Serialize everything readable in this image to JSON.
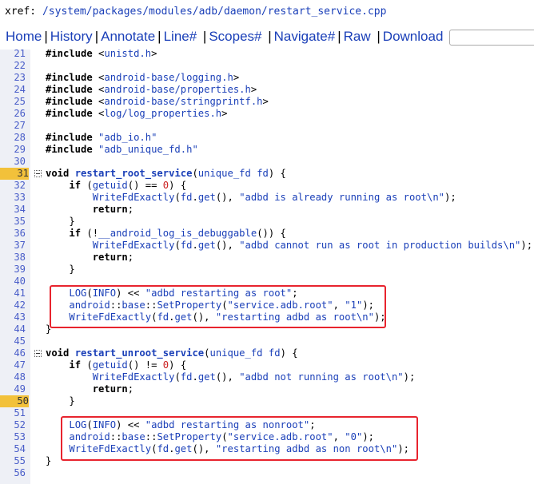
{
  "header": {
    "prefix": "xref: ",
    "path": "/system/packages/modules/adb/daemon/restart_service.cpp"
  },
  "nav": {
    "home": "Home",
    "history": "History",
    "annotate": "Annotate",
    "line": "Line#",
    "scopes": "Scopes#",
    "navigate": "Navigate#",
    "raw": "Raw",
    "download": "Download",
    "search_value": ""
  },
  "code_lines": [
    {
      "n": "21",
      "t": "#include <unistd.h>"
    },
    {
      "n": "22",
      "t": ""
    },
    {
      "n": "23",
      "t": "#include <android-base/logging.h>"
    },
    {
      "n": "24",
      "t": "#include <android-base/properties.h>"
    },
    {
      "n": "25",
      "t": "#include <android-base/stringprintf.h>"
    },
    {
      "n": "26",
      "t": "#include <log/log_properties.h>"
    },
    {
      "n": "27",
      "t": ""
    },
    {
      "n": "28",
      "t": "#include \"adb_io.h\""
    },
    {
      "n": "29",
      "t": "#include \"adb_unique_fd.h\""
    },
    {
      "n": "30",
      "t": ""
    },
    {
      "n": "31",
      "t": "void restart_root_service(unique_fd fd) {"
    },
    {
      "n": "32",
      "t": "    if (getuid() == 0) {"
    },
    {
      "n": "33",
      "t": "        WriteFdExactly(fd.get(), \"adbd is already running as root\\n\");"
    },
    {
      "n": "34",
      "t": "        return;"
    },
    {
      "n": "35",
      "t": "    }"
    },
    {
      "n": "36",
      "t": "    if (!__android_log_is_debuggable()) {"
    },
    {
      "n": "37",
      "t": "        WriteFdExactly(fd.get(), \"adbd cannot run as root in production builds\\n\");"
    },
    {
      "n": "38",
      "t": "        return;"
    },
    {
      "n": "39",
      "t": "    }"
    },
    {
      "n": "40",
      "t": ""
    },
    {
      "n": "41",
      "t": "    LOG(INFO) << \"adbd restarting as root\";"
    },
    {
      "n": "42",
      "t": "    android::base::SetProperty(\"service.adb.root\", \"1\");"
    },
    {
      "n": "43",
      "t": "    WriteFdExactly(fd.get(), \"restarting adbd as root\\n\");"
    },
    {
      "n": "44",
      "t": "}"
    },
    {
      "n": "45",
      "t": ""
    },
    {
      "n": "46",
      "t": "void restart_unroot_service(unique_fd fd) {"
    },
    {
      "n": "47",
      "t": "    if (getuid() != 0) {"
    },
    {
      "n": "48",
      "t": "        WriteFdExactly(fd.get(), \"adbd not running as root\\n\");"
    },
    {
      "n": "49",
      "t": "        return;"
    },
    {
      "n": "50",
      "t": "    }"
    },
    {
      "n": "51",
      "t": ""
    },
    {
      "n": "52",
      "t": "    LOG(INFO) << \"adbd restarting as nonroot\";"
    },
    {
      "n": "53",
      "t": "    android::base::SetProperty(\"service.adb.root\", \"0\");"
    },
    {
      "n": "54",
      "t": "    WriteFdExactly(fd.get(), \"restarting adbd as non root\\n\");"
    },
    {
      "n": "55",
      "t": "}"
    },
    {
      "n": "56",
      "t": ""
    }
  ],
  "highlighted_lines": [
    "31",
    "50"
  ],
  "colors": {
    "link": "#1a3fb8",
    "gutter_bg": "#eef0f6",
    "highlight_num": "#f2c13a",
    "annotation_box": "#e8242e",
    "number_literal": "#cc2222"
  }
}
